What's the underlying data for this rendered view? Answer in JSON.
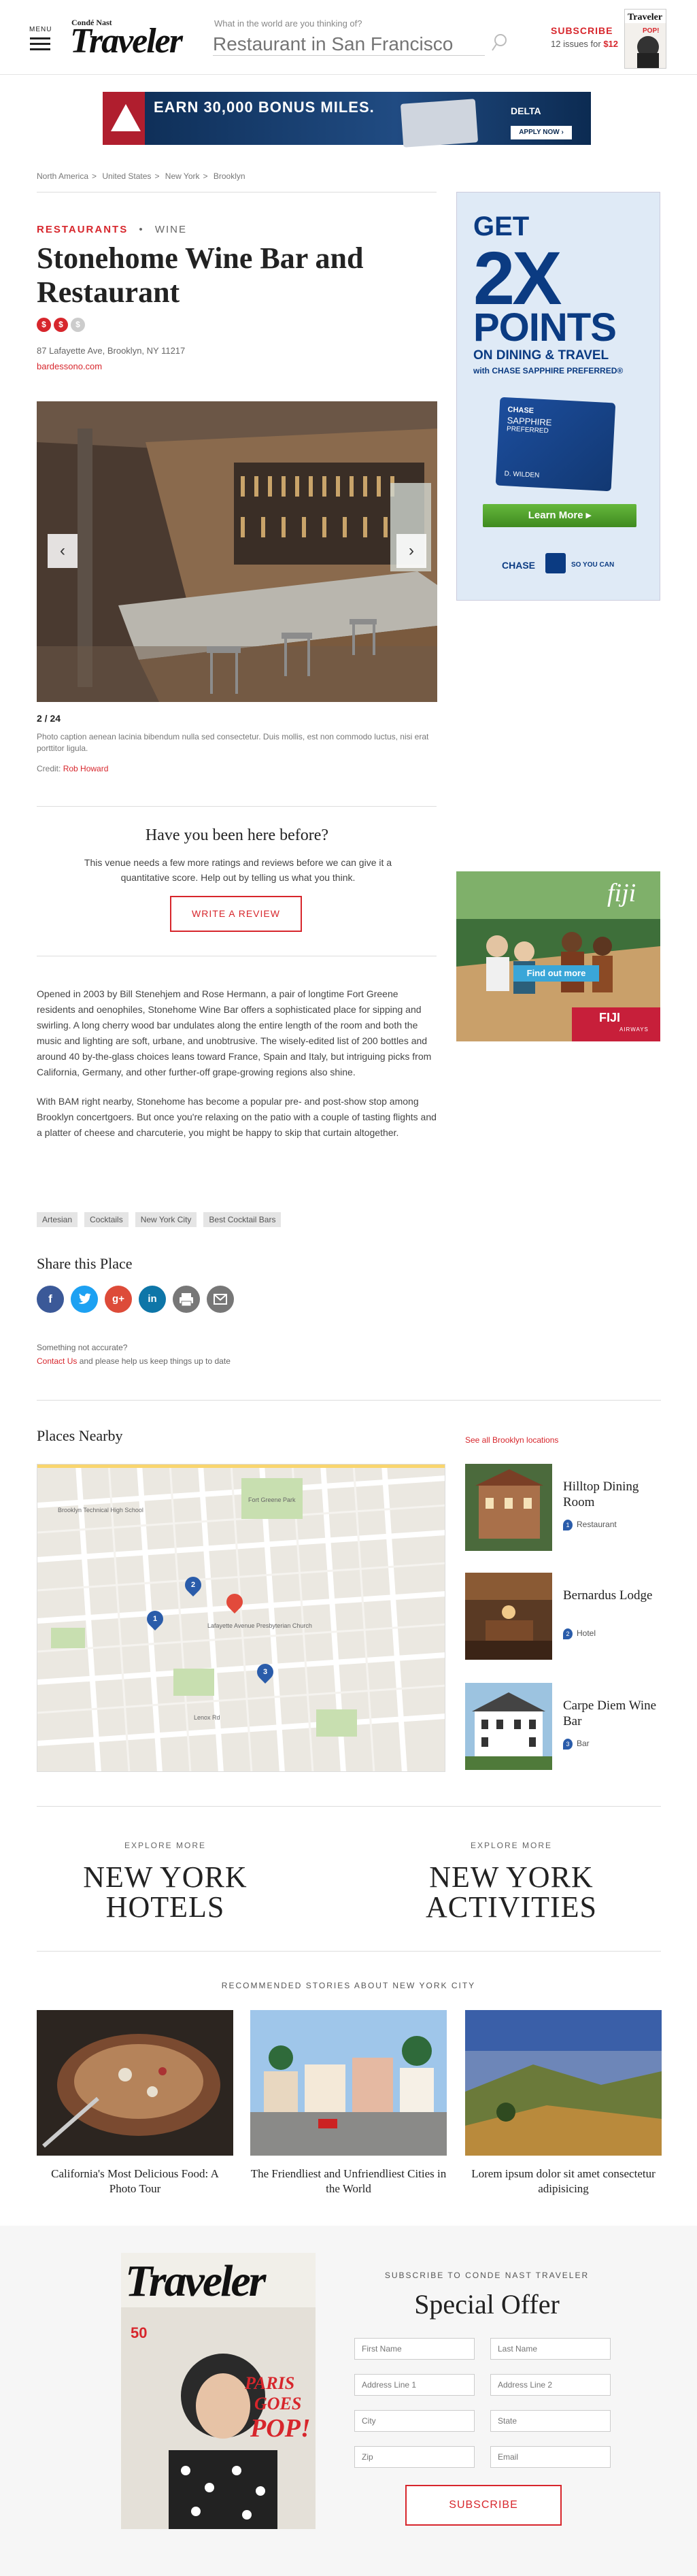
{
  "header": {
    "menu_label": "MENU",
    "logo_small": "Condé Nast",
    "logo_big": "Traveler",
    "search_question": "What in the world are you thinking of?",
    "search_placeholder": "Restaurant in San Francisco",
    "subscribe_label": "SUBSCRIBE",
    "subscribe_offer_prefix": "12 issues for ",
    "subscribe_offer_price": "$12"
  },
  "banner_ad": {
    "text": "EARN 30,000 BONUS MILES.",
    "brand": "DELTA",
    "cta": "APPLY NOW ›"
  },
  "breadcrumb": [
    "North America",
    "United States",
    "New York",
    "Brooklyn"
  ],
  "breadcrumb_sep": ">",
  "venue": {
    "category": "RESTAURANTS",
    "category_sep": "•",
    "subcategory": "WINE",
    "title": "Stonehome Wine Bar and Restaurant",
    "price_symbols": [
      "$",
      "$",
      "$"
    ],
    "address": "87 Lafayette Ave, Brooklyn, NY 11217",
    "website": "bardessono.com"
  },
  "gallery": {
    "counter": "2 / 24",
    "caption": "Photo caption aenean lacinia bibendum nulla sed consectetur. Duis mollis, est non commodo luctus, nisi erat porttitor ligula.",
    "credit_label": "Credit: ",
    "credit_name": "Rob Howard"
  },
  "review_prompt": {
    "heading": "Have you been here before?",
    "text": "This venue needs a few more ratings and reviews before we can give it a quantitative score. Help out by telling us what you think.",
    "button": "WRITE A REVIEW"
  },
  "description": [
    "Opened in 2003 by Bill Stenehjem and Rose Hermann, a pair of longtime Fort Greene residents and oenophiles, Stonehome Wine Bar offers a sophisticated place for sipping and swirling. A long cherry wood bar undulates along the entire length of the room and both the music and lighting are soft, urbane, and unobtrusive. The wisely-edited list of 200 bottles and around 40 by-the-glass choices leans toward France, Spain and Italy, but intriguing picks from California, Germany, and other further-off grape-growing regions also shine.",
    "With BAM right nearby, Stonehome has become a popular pre- and post-show stop among Brooklyn concertgoers. But once you're relaxing on the patio with a couple of tasting flights and a platter of cheese and charcuterie, you might be happy to skip that curtain altogether."
  ],
  "tags": [
    "Artesian",
    "Cocktails",
    "New York City",
    "Best Cocktail Bars"
  ],
  "share": {
    "title": "Share this Place",
    "icons": [
      "facebook-icon",
      "twitter-icon",
      "google-plus-icon",
      "linkedin-icon",
      "print-icon",
      "email-icon"
    ]
  },
  "accuracy": {
    "line1": "Something not accurate?",
    "link": "Contact Us",
    "line2_rest": " and please help us keep things up to date"
  },
  "side_ad_1": {
    "get": "GET",
    "big": "2X",
    "points": "POINTS",
    "on": "ON DINING & TRAVEL",
    "with": "with CHASE SAPPHIRE PREFERRED®",
    "card_brand": "CHASE",
    "card_name": "SAPPHIRE",
    "card_sub": "PREFERRED",
    "card_holder": "D. WILDEN",
    "cta": "Learn More ▸",
    "footer": "CHASE",
    "footer2": "SO YOU CAN"
  },
  "side_ad_2": {
    "logo": "fiji",
    "cta": "Find out more",
    "airline": "FIJI",
    "airline_sub": "AIRWAYS"
  },
  "nearby": {
    "title": "Places Nearby",
    "link": "See all Brooklyn locations",
    "map_labels": [
      "Brooklyn Technical High School",
      "Fort Greene Park",
      "Lafayette Avenue Presbyterian Church",
      "Lenox Rd"
    ],
    "map_pins": [
      "1",
      "2",
      "3"
    ],
    "places": [
      {
        "name": "Hilltop Dining Room",
        "type": "Restaurant",
        "num": "1"
      },
      {
        "name": "Bernardus Lodge",
        "type": "Hotel",
        "num": "2"
      },
      {
        "name": "Carpe Diem Wine Bar",
        "type": "Bar",
        "num": "3"
      }
    ]
  },
  "explore": [
    {
      "kicker": "EXPLORE MORE",
      "title": "NEW YORK HOTELS"
    },
    {
      "kicker": "EXPLORE MORE",
      "title": "NEW YORK ACTIVITIES"
    }
  ],
  "recommended": {
    "title": "RECOMMENDED STORIES ABOUT NEW YORK CITY",
    "stories": [
      {
        "caption": "California's Most Delicious Food: A Photo Tour"
      },
      {
        "caption": "The Friendliest and Unfriendliest Cities in the World"
      },
      {
        "caption": "Lorem ipsum dolor sit amet consectetur adipisicing"
      }
    ]
  },
  "subscribe_footer": {
    "kicker": "SUBSCRIBE TO CONDE NAST TRAVELER",
    "title": "Special Offer",
    "magazine_logo": "Traveler",
    "magazine_headline": "PARIS GOES POP!",
    "fields": [
      "First Name",
      "Last Name",
      "Address Line 1",
      "Address Line 2",
      "City",
      "State",
      "Zip",
      "Email"
    ],
    "button": "SUBSCRIBE"
  },
  "colors": {
    "accent": "#d7262c",
    "chase_blue": "#0b3b82",
    "pin_blue": "#2a5caa"
  }
}
